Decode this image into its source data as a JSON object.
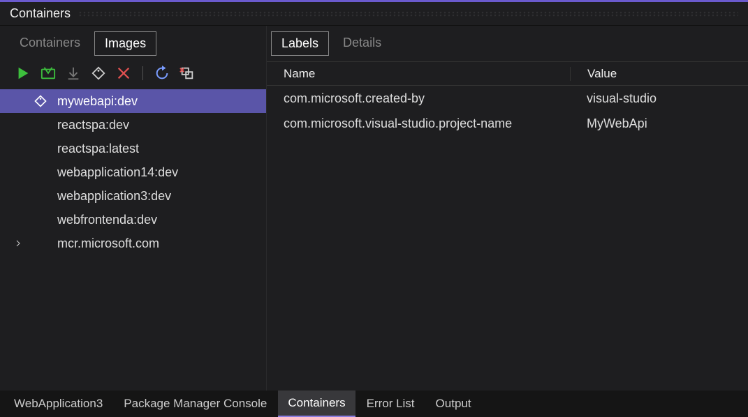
{
  "panel_title": "Containers",
  "left_tabs": {
    "containers": "Containers",
    "images": "Images",
    "active": "Images"
  },
  "toolbar_icons": [
    "run-icon",
    "open-icon",
    "download-icon",
    "tag-icon",
    "delete-icon",
    "refresh-icon",
    "prune-icon"
  ],
  "images": [
    {
      "name": "mywebapi:dev",
      "selected": true,
      "tagIcon": true
    },
    {
      "name": "reactspa:dev"
    },
    {
      "name": "reactspa:latest"
    },
    {
      "name": "webapplication14:dev"
    },
    {
      "name": "webapplication3:dev"
    },
    {
      "name": "webfrontenda:dev"
    },
    {
      "name": "mcr.microsoft.com",
      "expandable": true
    }
  ],
  "detail_tabs": {
    "labels": "Labels",
    "details": "Details",
    "active": "Labels"
  },
  "table": {
    "columns": {
      "name": "Name",
      "value": "Value"
    },
    "rows": [
      {
        "name": "com.microsoft.created-by",
        "value": "visual-studio"
      },
      {
        "name": "com.microsoft.visual-studio.project-name",
        "value": "MyWebApi"
      }
    ]
  },
  "bottom_tabs": [
    {
      "label": "WebApplication3"
    },
    {
      "label": "Package Manager Console"
    },
    {
      "label": "Containers",
      "active": true
    },
    {
      "label": "Error List"
    },
    {
      "label": "Output"
    }
  ]
}
